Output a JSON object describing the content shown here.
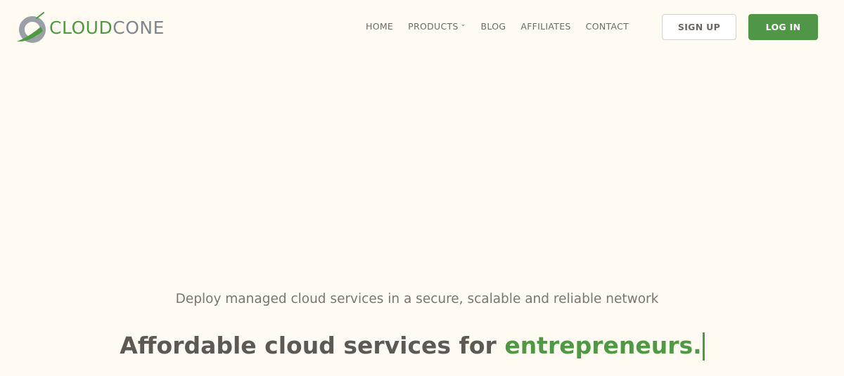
{
  "brand": {
    "name_part1": "CLOUD",
    "name_part2": "CONE",
    "logo_icon": "cloudcone-logo-icon",
    "colors": {
      "green": "#4e9a43",
      "gray": "#7f868c",
      "background": "#fffbf3"
    }
  },
  "nav": {
    "items": [
      {
        "label": "HOME"
      },
      {
        "label": "PRODUCTS",
        "has_dropdown": true,
        "dropdown_icon": "chevron-down-icon"
      },
      {
        "label": "BLOG"
      },
      {
        "label": "AFFILIATES"
      },
      {
        "label": "CONTACT"
      }
    ]
  },
  "actions": {
    "signup_label": "SIGN UP",
    "login_label": "LOG IN"
  },
  "hero": {
    "subtitle": "Deploy managed cloud services in a secure, scalable and reliable network",
    "title_prefix": "Affordable cloud services for ",
    "title_highlight": "entrepreneurs."
  }
}
